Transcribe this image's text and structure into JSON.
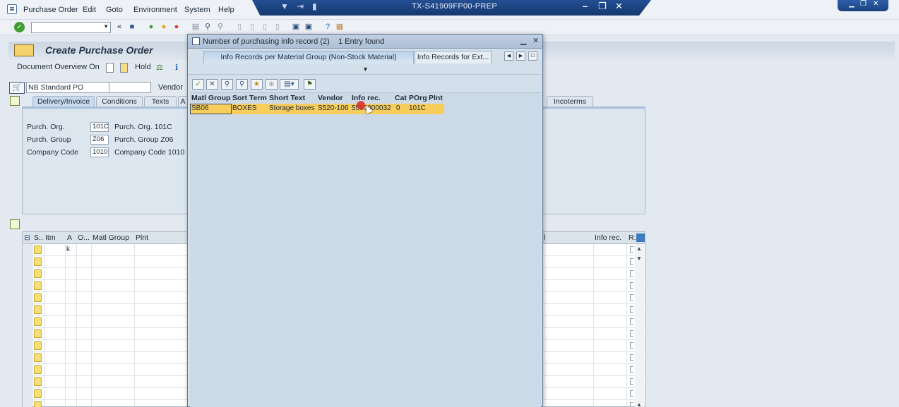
{
  "menu": [
    "Purchase Order",
    "Edit",
    "Goto",
    "Environment",
    "System",
    "Help"
  ],
  "window": {
    "title": "TX-S41909FP00-PREP"
  },
  "toolbar": {
    "command_field": ""
  },
  "page": {
    "title": "Create Purchase Order",
    "doc_overview": "Document Overview On",
    "hold": "Hold"
  },
  "po": {
    "type": "NB Standard PO",
    "vendor_label": "Vendor"
  },
  "header_tabs": [
    "Delivery/Invoice",
    "Conditions",
    "Texts",
    "A",
    "Incoterms"
  ],
  "header_fields": [
    {
      "label": "Purch. Org.",
      "value": "101C",
      "desc": "Purch. Org. 101C"
    },
    {
      "label": "Purch. Group",
      "value": "Z06",
      "desc": "Purch. Group Z06"
    },
    {
      "label": "Company Code",
      "value": "1010",
      "desc": "Company Code 1010"
    }
  ],
  "item_grid": {
    "columns": [
      "S..",
      "Itm",
      "A",
      "O...",
      "Matl Group",
      "Plnt",
      "l",
      "Info rec.",
      "R."
    ],
    "first_row_a": "k"
  },
  "dialog": {
    "title": "Number of purchasing info record (2)",
    "entries": "1 Entry found",
    "tabs": [
      "Info Records per Material Group (Non-Stock Material)",
      "Info Records for Ext..."
    ],
    "columns": [
      "Matl Group",
      "Sort Term",
      "Short Text",
      "Vendor",
      "Info rec.",
      "Cat",
      "POrg",
      "Plnt"
    ],
    "rows": [
      {
        "matl_group": "SB06",
        "sort_term": "BOXES",
        "short_text": "Storage boxes",
        "vendor": "S520-106",
        "info_rec": "5500000032",
        "cat": "0",
        "porg": "101C",
        "plnt": ""
      }
    ]
  },
  "colors": {
    "title_bar": "#1c4383",
    "highlight_row": "#f7cd5c",
    "dialog_bg": "#ccdae8"
  }
}
